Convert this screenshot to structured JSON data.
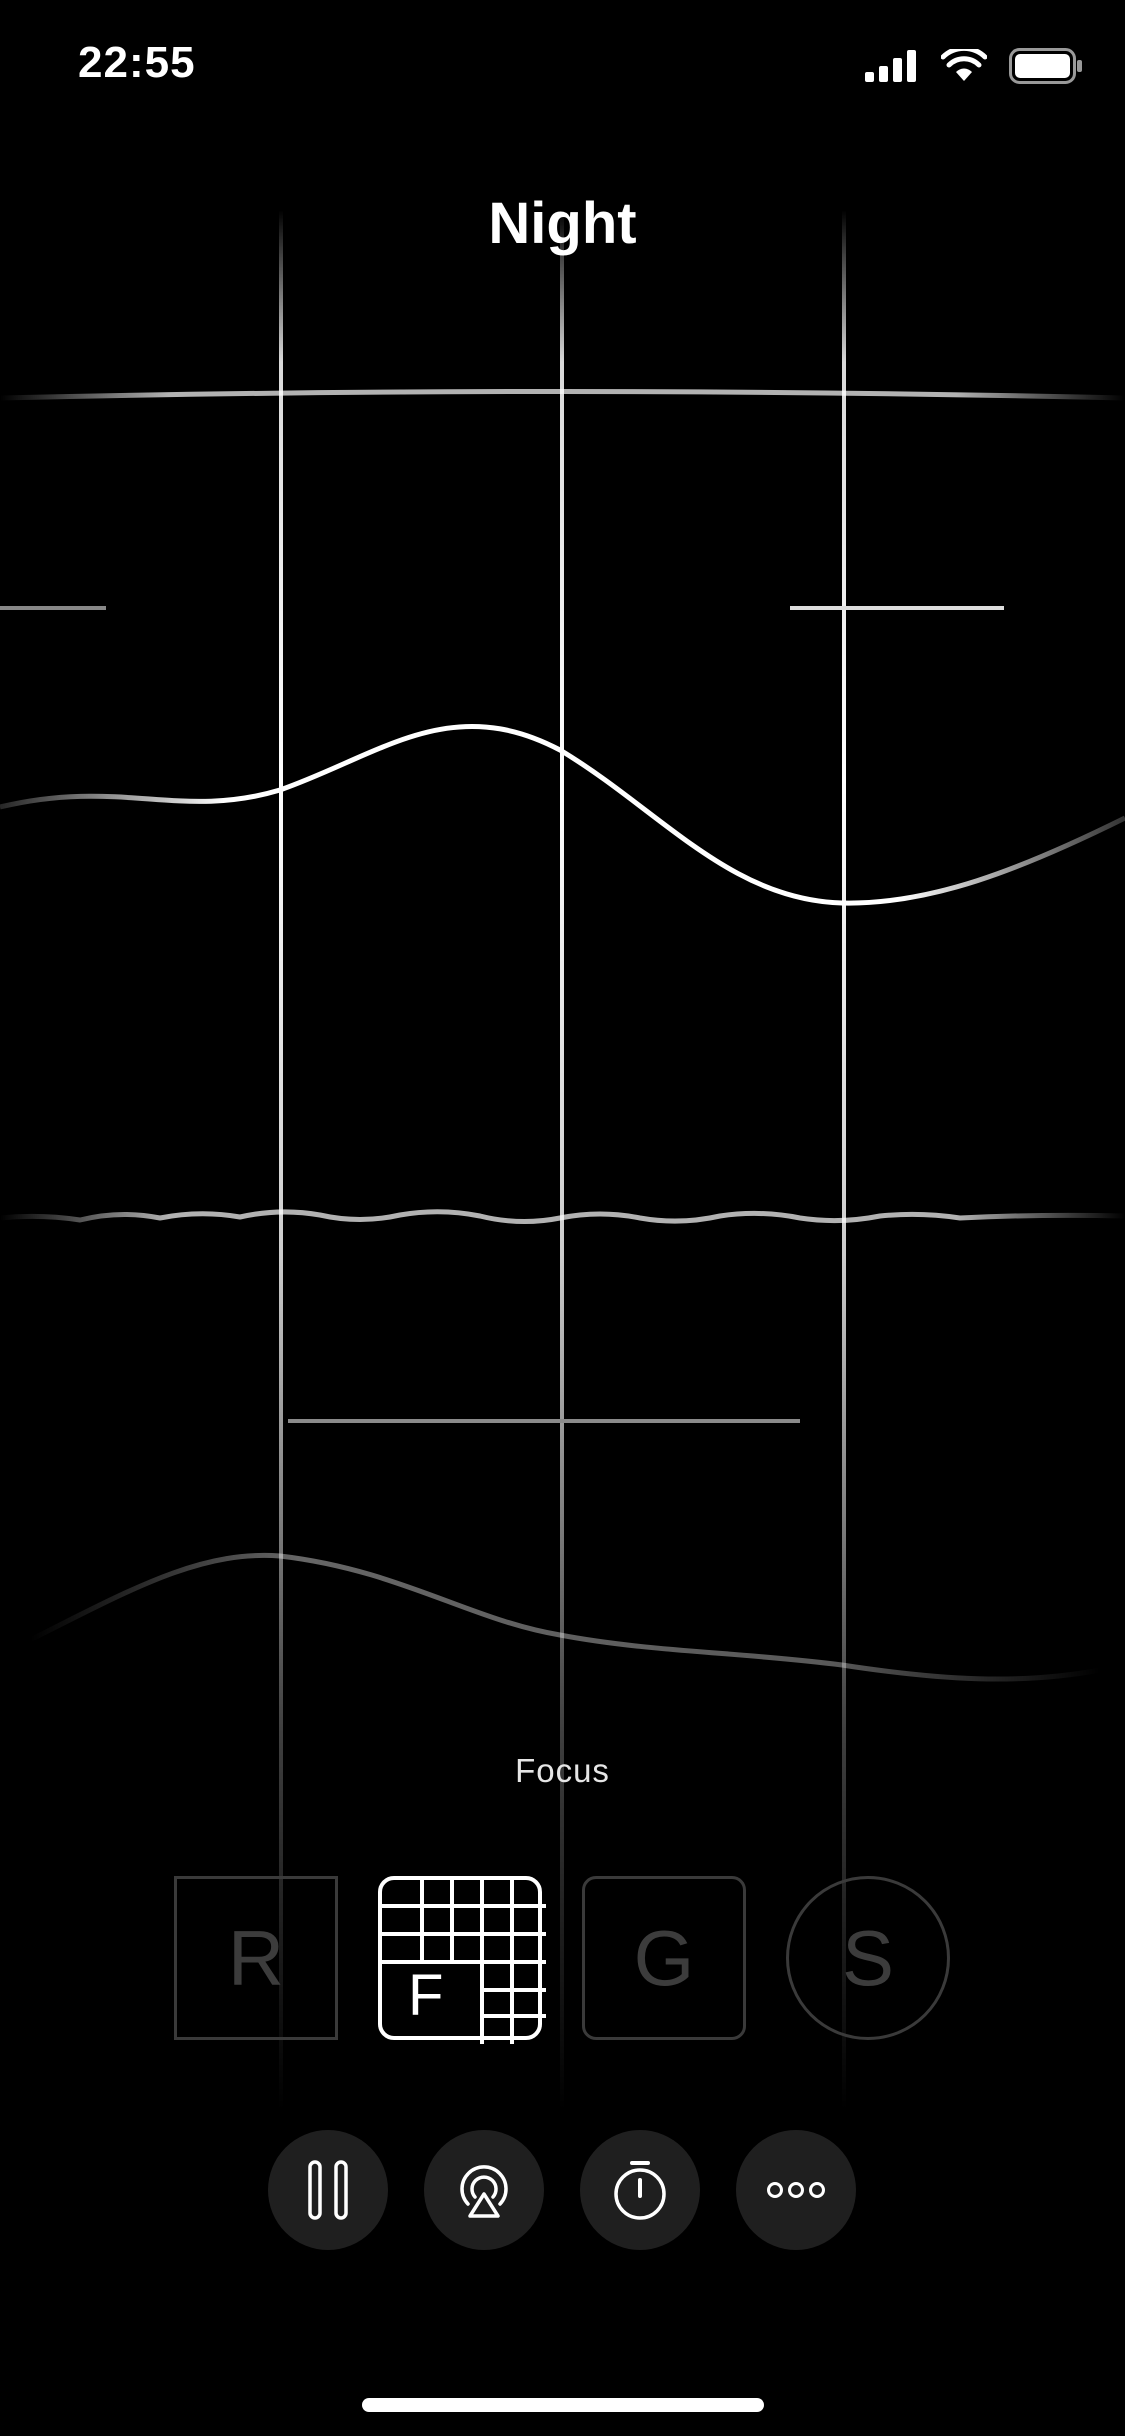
{
  "status_bar": {
    "time": "22:55",
    "icons": [
      "signal-icon",
      "wifi-icon",
      "battery-icon"
    ]
  },
  "header": {
    "title": "Night"
  },
  "mode": {
    "current_label": "Focus",
    "tiles": [
      {
        "letter": "R",
        "selected": false
      },
      {
        "letter": "F",
        "selected": true
      },
      {
        "letter": "G",
        "selected": false
      },
      {
        "letter": "S",
        "selected": false
      }
    ]
  },
  "controls": {
    "buttons": [
      "pause-icon",
      "airplay-icon",
      "timer-icon",
      "more-icon"
    ]
  },
  "colors": {
    "background": "#000000",
    "foreground": "#ffffff",
    "inactive_tile": "#3a3a3a",
    "button_bg": "#1f1f1f"
  }
}
